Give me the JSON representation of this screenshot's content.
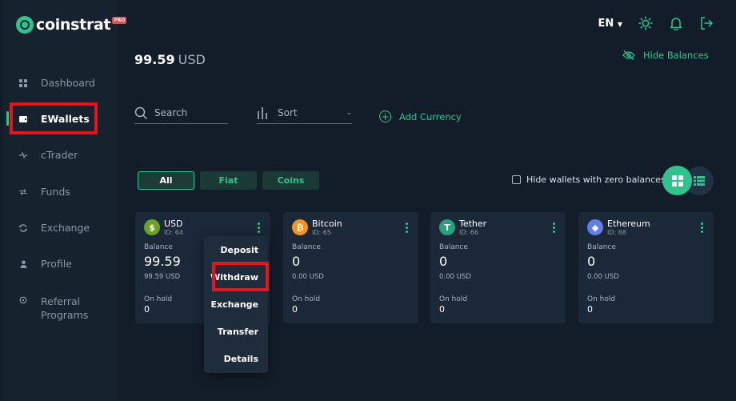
{
  "brand": {
    "name": "coinstrat",
    "badge": "PRO"
  },
  "sidebar": {
    "items": [
      {
        "label": "Dashboard"
      },
      {
        "label": "EWallets"
      },
      {
        "label": "cTrader"
      },
      {
        "label": "Funds"
      },
      {
        "label": "Exchange"
      },
      {
        "label": "Profile"
      },
      {
        "label": "Referral\nPrograms"
      }
    ]
  },
  "header": {
    "language": "EN",
    "total_balance": "99.59",
    "total_currency": "USD",
    "hide_balances": "Hide Balances"
  },
  "toolbar": {
    "search_placeholder": "Search",
    "sort_label": "Sort",
    "add_currency": "Add Currency"
  },
  "filters": [
    "All",
    "Fiat",
    "Coins"
  ],
  "hide_zero_label": "Hide wallets with zero balances",
  "wallets": [
    {
      "name": "USD",
      "id": "ID: 64",
      "balance_label": "Balance",
      "balance": "99.59",
      "balance_usd": "99.59 USD",
      "onhold_label": "On hold",
      "onhold": "0",
      "icon": "dollar-icon",
      "color": "#6aa225"
    },
    {
      "name": "Bitcoin",
      "id": "ID: 65",
      "balance_label": "Balance",
      "balance": "0",
      "balance_usd": "0.00 USD",
      "onhold_label": "On hold",
      "onhold": "0",
      "icon": "bitcoin-icon",
      "color": "#f39321"
    },
    {
      "name": "Tether",
      "id": "ID: 66",
      "balance_label": "Balance",
      "balance": "0",
      "balance_usd": "0.00 USD",
      "onhold_label": "On hold",
      "onhold": "0",
      "icon": "tether-icon",
      "color": "#26a17b"
    },
    {
      "name": "Ethereum",
      "id": "ID: 68",
      "balance_label": "Balance",
      "balance": "0",
      "balance_usd": "0.00 USD",
      "onhold_label": "On hold",
      "onhold": "0",
      "icon": "ethereum-icon",
      "color": "#627eea"
    }
  ],
  "context_menu": [
    "Deposit",
    "Withdraw",
    "Exchange",
    "Transfer",
    "Details"
  ],
  "colors": {
    "accent": "#2fc48d",
    "highlight": "#e8141a",
    "background": "#131d2a",
    "card": "#1a2838"
  }
}
